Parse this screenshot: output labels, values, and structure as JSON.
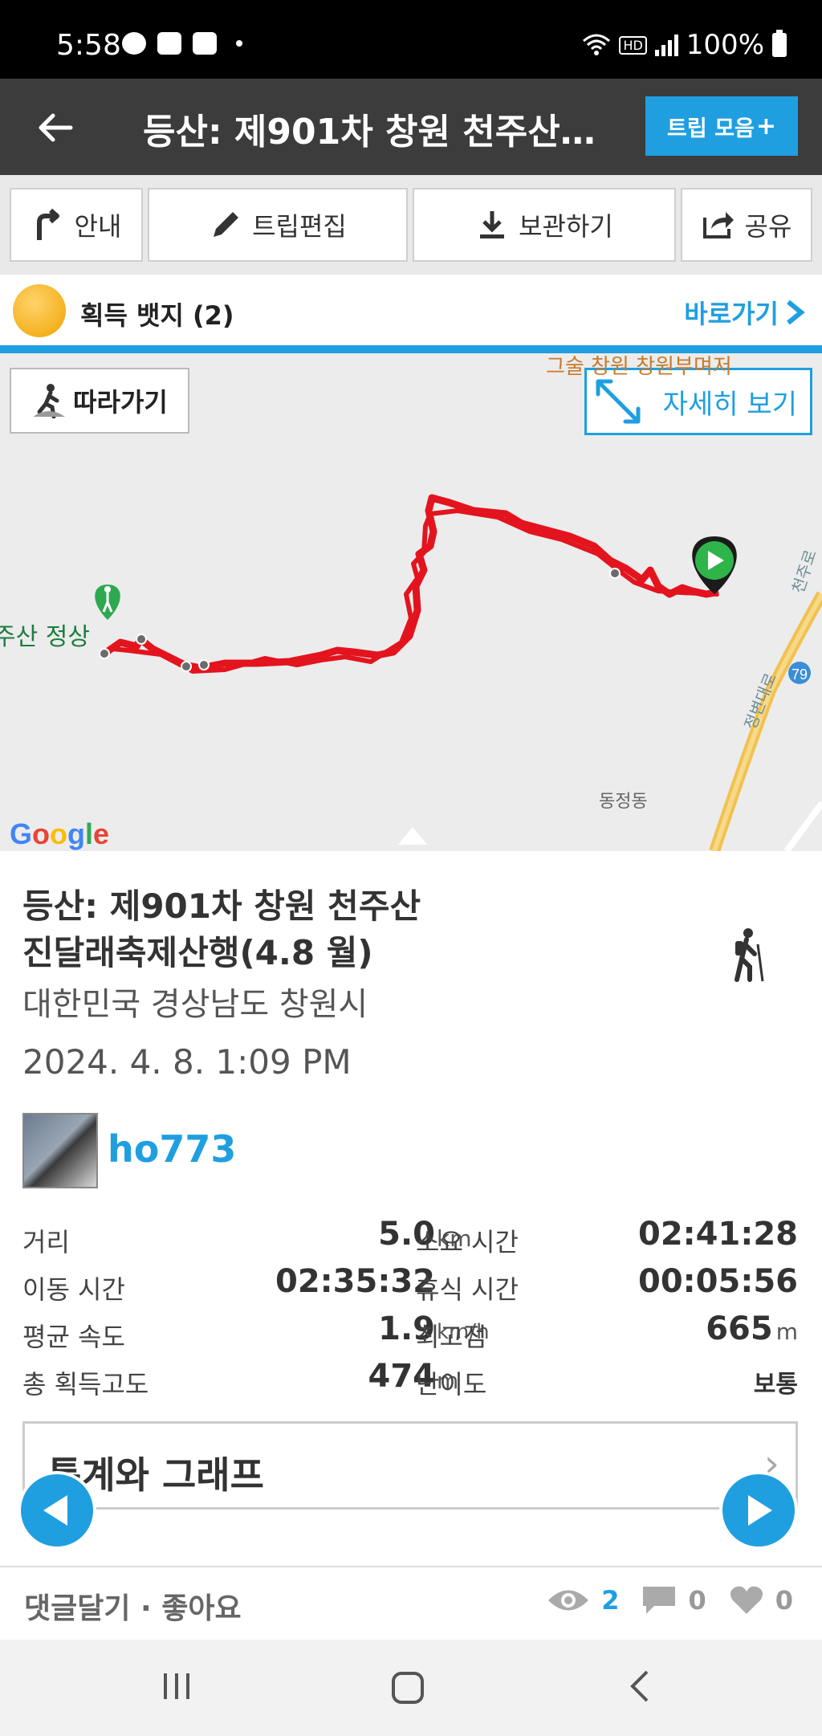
{
  "status_bar": {
    "time": "5:58",
    "hd": "HD",
    "battery": "100%"
  },
  "app_bar": {
    "title": "등산: 제901차 창원 천주산…",
    "trip_collection_label": "트립 모음",
    "plus": "+"
  },
  "toolbar": {
    "guide": "안내",
    "edit": "트립편집",
    "save": "보관하기",
    "share": "공유"
  },
  "badges": {
    "label": "획득 뱃지 (2)",
    "go": "바로가기"
  },
  "map": {
    "follow": "따라가기",
    "detail": "자세히 보기",
    "peak_label": "주산 정상",
    "dong_label": "동정동",
    "top_label": "그술 창원  창원부며저",
    "road_label_1": "천주로",
    "road_label_2": "정변대로",
    "road_number": "79",
    "google": [
      "G",
      "o",
      "o",
      "g",
      "l",
      "e"
    ]
  },
  "trip": {
    "title_line1": "등산: 제901차 창원 천주산",
    "title_line2": "진달래축제산행(4.8 월)",
    "location": "대한민국 경상남도 창원시",
    "datetime": "2024. 4. 8. 1:09 PM",
    "username": "ho773"
  },
  "stats": [
    {
      "k1": "거리",
      "v1": "5.0",
      "u1": "km",
      "k2": "소요 시간",
      "v2": "02:41:28",
      "u2": ""
    },
    {
      "k1": "이동 시간",
      "v1": "02:35:32",
      "u1": "",
      "k2": "휴식 시간",
      "v2": "00:05:56",
      "u2": ""
    },
    {
      "k1": "평균 속도",
      "v1": "1.9",
      "u1": "km/h",
      "k2": "최고점",
      "v2": "665",
      "u2": "m"
    },
    {
      "k1": "총 획득고도",
      "v1": "474",
      "u1": "m",
      "k2": "난이도",
      "v2": "보통",
      "u2": ""
    }
  ],
  "stats_button": {
    "label": "통계와 그래프",
    "chevron": "›"
  },
  "footer": {
    "actions": "댓글달기 · 좋아요",
    "views": "2",
    "comments": "0",
    "likes": "0"
  },
  "colors": {
    "accent": "#1f9fe0",
    "route": "#e3141e",
    "appbar": "#3c3c3c"
  }
}
